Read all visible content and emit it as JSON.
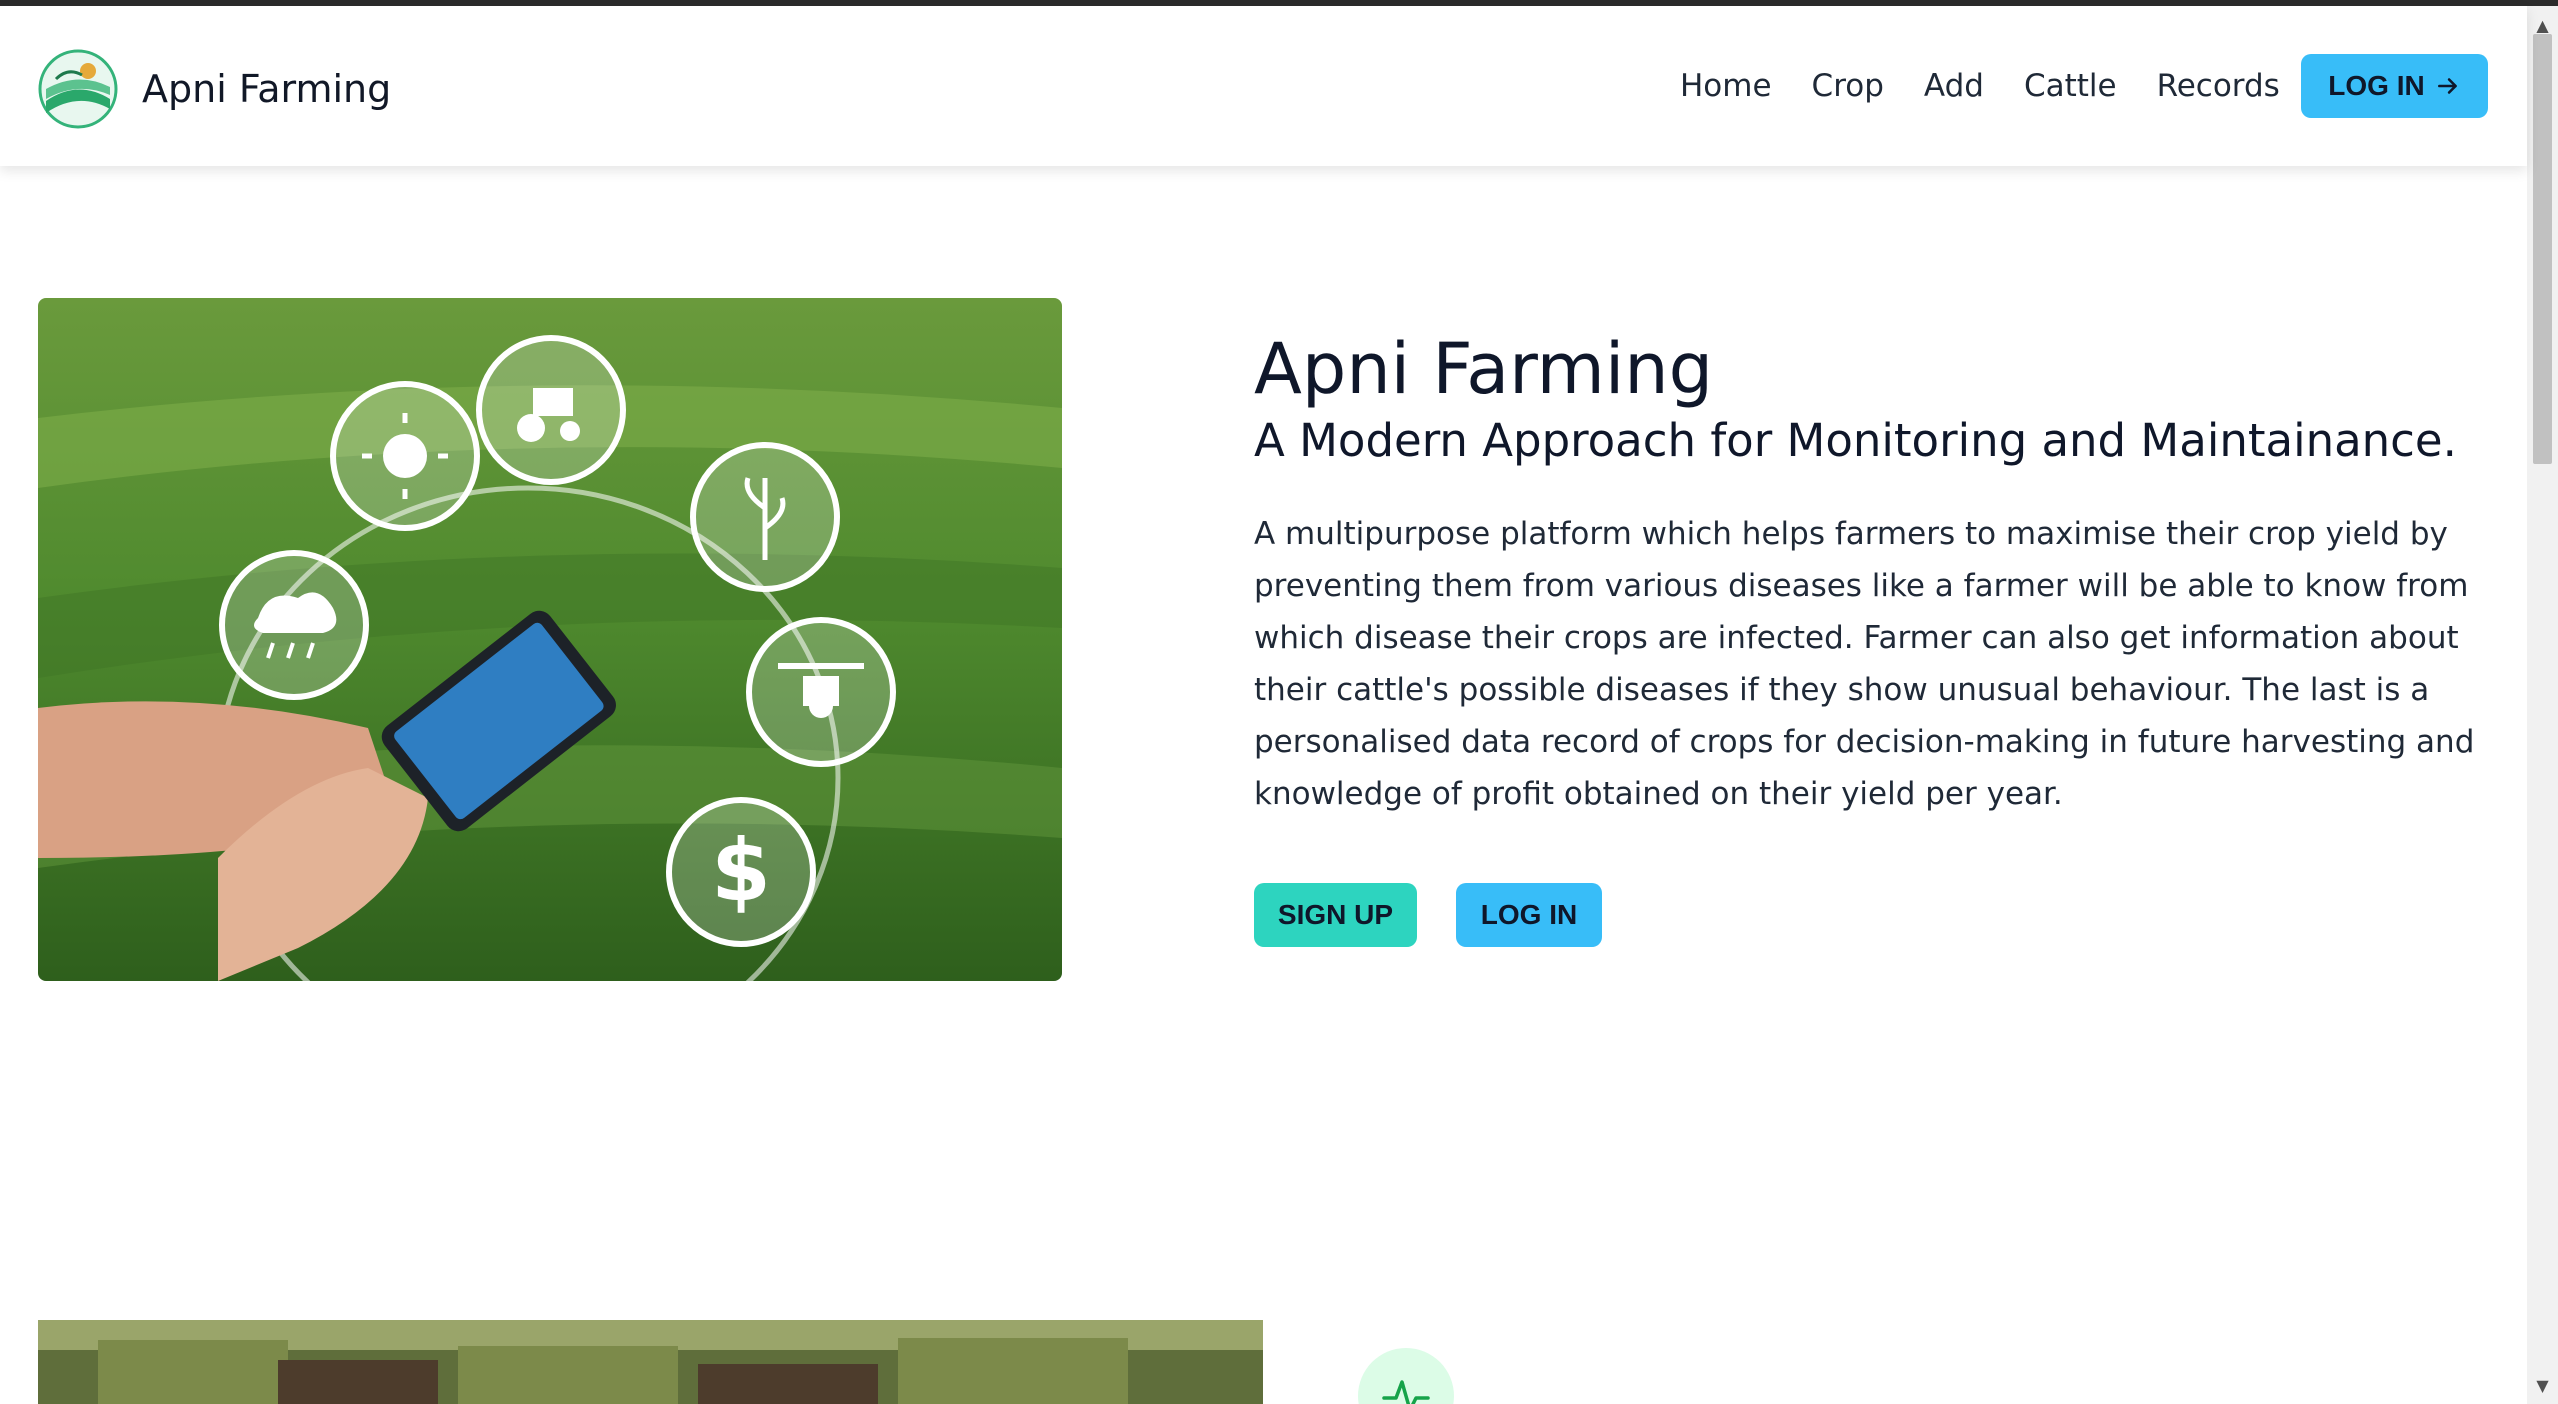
{
  "brand": {
    "name": "Apni Farming",
    "logo_icon": "farm-logo-icon"
  },
  "nav": {
    "links": [
      "Home",
      "Crop",
      "Add",
      "Cattle",
      "Records"
    ],
    "login_label": "LOG IN",
    "login_icon": "arrow-right-icon"
  },
  "hero": {
    "title": "Apni Farming",
    "subtitle": "A Modern Approach for Monitoring and Maintainance.",
    "description": "A multipurpose platform which helps farmers to maximise their crop yield by preventing them from various diseases like a farmer will be able to know from which disease their crops are infected. Farmer can also get information about their cattle's possible diseases if they show unusual behaviour. The last is a personalised data record of crops for decision-making in future harvesting and knowledge of profit obtained on their yield per year.",
    "signup_label": "SIGN UP",
    "login_label": "LOG IN"
  },
  "colors": {
    "accent_blue": "#38bdf8",
    "accent_teal": "#2dd4bf",
    "text_dark": "#0f172a"
  }
}
